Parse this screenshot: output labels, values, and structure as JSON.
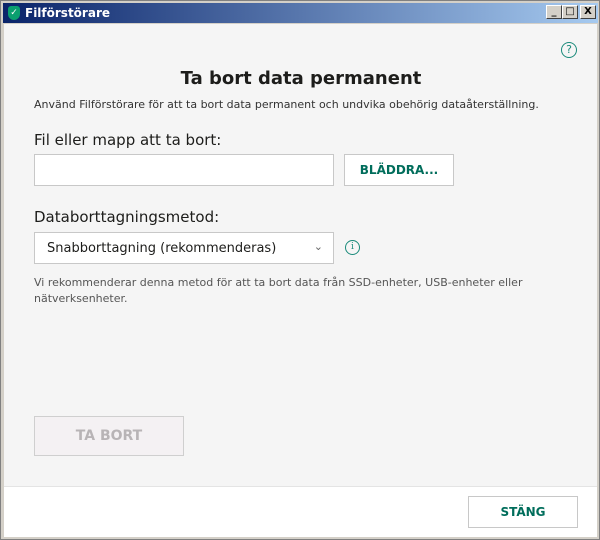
{
  "window": {
    "title": "Filförstörare",
    "minimize": "_",
    "maximize": "□",
    "close": "X"
  },
  "main": {
    "heading": "Ta bort data permanent",
    "description": "Använd Filförstörare för att ta bort data permanent och undvika obehörig dataåterställning.",
    "file_label": "Fil eller mapp att ta bort:",
    "file_value": "",
    "browse_label": "BLÄDDRA...",
    "method_label": "Databorttagningsmetod:",
    "method_value": "Snabborttagning (rekommenderas)",
    "method_hint": "Vi rekommenderar denna metod för att ta bort data från SSD-enheter, USB-enheter eller nätverksenheter.",
    "delete_label": "TA BORT"
  },
  "footer": {
    "close_label": "STÄNG"
  },
  "colors": {
    "accent": "#006d5b",
    "icon": "#1a8a7a"
  }
}
